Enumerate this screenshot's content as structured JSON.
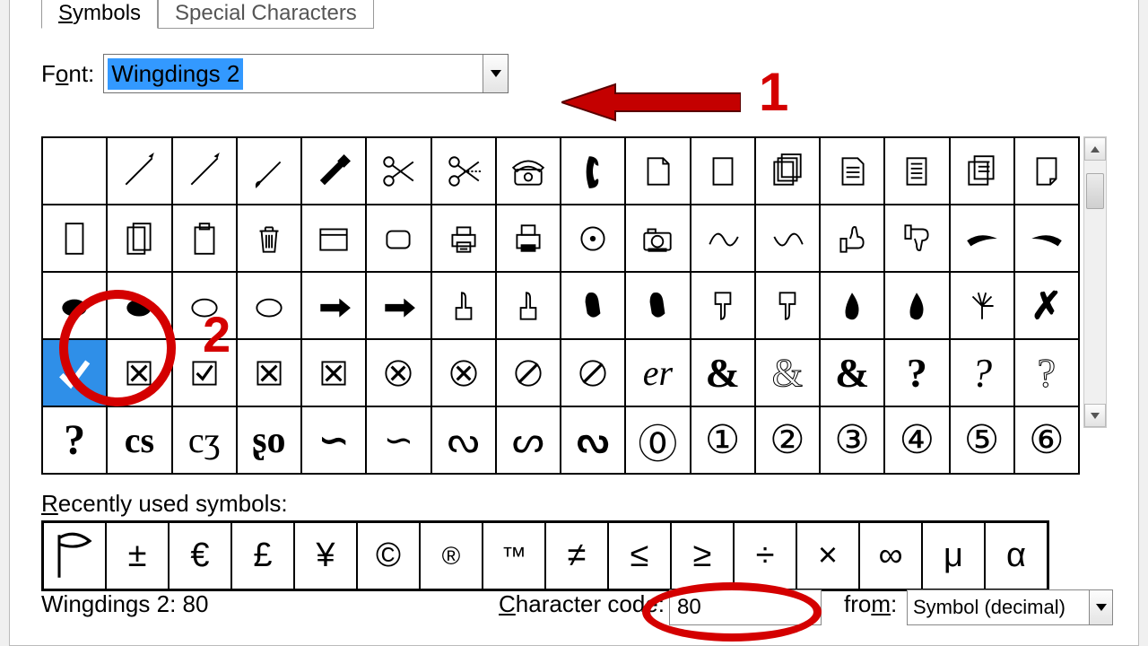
{
  "tabs": {
    "symbols": "Symbols",
    "special": "Special Characters"
  },
  "font": {
    "label_pre": "F",
    "label_und": "o",
    "label_post": "nt:",
    "value": "Wingdings 2"
  },
  "annotations": {
    "one": "1",
    "two": "2"
  },
  "grid": [
    [
      "blank",
      "pen",
      "pen",
      "brush",
      "marker",
      "scissors",
      "scissors-cut",
      "telephone",
      "handset",
      "doc-blank",
      "doc-page",
      "docs-stack",
      "doc-text",
      "doc-lines",
      "docs-text",
      "doc-folded"
    ],
    [
      "page-blank",
      "pages",
      "clipboard",
      "trash",
      "window",
      "round-rect",
      "printer",
      "fax",
      "disc",
      "camera",
      "squiggle-l",
      "squiggle-r",
      "thumbs-up",
      "thumbs-down",
      "wave-l",
      "wave-r"
    ],
    [
      "fist-solid",
      "fist-solid",
      "fist-outline",
      "fist-outline",
      "point-r-solid",
      "point-r-solid",
      "finger-up",
      "finger-up",
      "mitten-solid",
      "mitten-solid",
      "point-down",
      "point-down",
      "drop-solid",
      "drop-solid",
      "hand-spread",
      "x-mark"
    ],
    [
      "check",
      "box-x",
      "box-check",
      "box-x",
      "box-x",
      "circle-x",
      "circle-x",
      "prohibit",
      "prohibit",
      "script-er",
      "amp-bold",
      "amp-outline",
      "amp-heavy",
      "q-serif",
      "q-italic",
      "q-outline"
    ],
    [
      "q-heavy",
      "cs1",
      "cs2",
      "cs3",
      "cs4",
      "cs5",
      "cs6",
      "cs7",
      "cs8",
      "circled-0",
      "circled-1",
      "circled-2",
      "circled-3",
      "circled-4",
      "circled-5",
      "circled-6"
    ]
  ],
  "selected": {
    "row": 3,
    "col": 0
  },
  "recent_label_pre": "R",
  "recent_label_und": "e",
  "recent_label_post": "cently used symbols:",
  "recent": [
    "flag",
    "±",
    "€",
    "£",
    "¥",
    "©",
    "®",
    "™",
    "≠",
    "≤",
    "≥",
    "÷",
    "×",
    "∞",
    "μ",
    "α"
  ],
  "status": "Wingdings 2: 80",
  "ccode": {
    "label_und": "C",
    "label_post": "haracter code:",
    "value": "80"
  },
  "from": {
    "label": "fro",
    "label_und": "m",
    "label_post": ":",
    "value": "Symbol (decimal)"
  }
}
